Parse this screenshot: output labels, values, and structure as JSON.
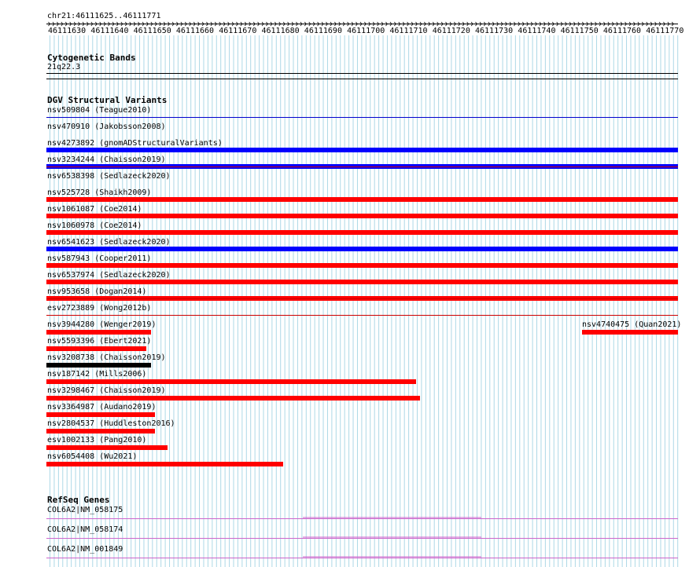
{
  "location": "chr21:46111625..46111771",
  "colors": {
    "grid": "#add8e6",
    "gain": "#0000ff",
    "loss": "#ff0000",
    "complex": "#000000",
    "gene": "#cc66cc",
    "separator_red": "#cc0000",
    "separator_blue": "#0000cc"
  },
  "ruler": {
    "ticks": [
      "46111630",
      "46111640",
      "46111650",
      "46111660",
      "46111670",
      "46111680",
      "46111690",
      "46111700",
      "46111710",
      "46111720",
      "46111730",
      "46111740",
      "46111750",
      "46111760",
      "46111770"
    ]
  },
  "tracks": {
    "cytoband": {
      "title": "Cytogenetic Bands",
      "band": "21q22.3"
    },
    "dgv": {
      "title": "DGV Structural Variants",
      "variants": [
        {
          "label": "nsv509804 (Teague2010)",
          "type": "none",
          "sep": "blue"
        },
        {
          "label": "nsv470910 (Jakobsson2008)",
          "type": "gain",
          "sep": "blue"
        },
        {
          "label": "nsv4273892 (gnomADStructuralVariants)",
          "type": "gain",
          "sep": "blue"
        },
        {
          "label": "nsv3234244 (Chaisson2019)",
          "type": "none",
          "sep": "red"
        },
        {
          "label": "nsv6538398 (Sedlazeck2020)",
          "type": "loss",
          "sep": "red"
        },
        {
          "label": "nsv525728 (Shaikh2009)",
          "type": "loss",
          "sep": "red"
        },
        {
          "label": "nsv1061087 (Coe2014)",
          "type": "loss",
          "sep": "red"
        },
        {
          "label": "nsv1060978 (Coe2014)",
          "type": "gain",
          "sep": "red"
        },
        {
          "label": "nsv6541623 (Sedlazeck2020)",
          "type": "loss",
          "sep": "red"
        },
        {
          "label": "nsv587943 (Cooper2011)",
          "type": "loss",
          "sep": "red"
        },
        {
          "label": "nsv6537974 (Sedlazeck2020)",
          "type": "loss",
          "sep": "red"
        },
        {
          "label": "nsv953658 (Dogan2014)",
          "type": "none",
          "sep": "red"
        },
        {
          "label": "esv2723889 (Wong2012b)",
          "type": "none",
          "sep": "red"
        }
      ],
      "partial": [
        {
          "label": "nsv3944280 (Wenger2019)",
          "type": "loss"
        },
        {
          "label": "nsv5593396 (Ebert2021)",
          "type": "loss"
        },
        {
          "label": "nsv3208738 (Chaisson2019)",
          "type": "complex"
        },
        {
          "label": "nsv187142 (Mills2006)",
          "type": "loss"
        },
        {
          "label": "nsv3298467 (Chaisson2019)",
          "type": "loss"
        },
        {
          "label": "nsv3364987 (Audano2019)",
          "type": "loss"
        },
        {
          "label": "nsv2804537 (Huddleston2016)",
          "type": "loss"
        },
        {
          "label": "esv1002133 (Pang2010)",
          "type": "loss"
        },
        {
          "label": "nsv6054408 (Wu2021)",
          "type": "loss"
        }
      ],
      "right_variant": {
        "label": "nsv4740475 (Quan2021)",
        "type": "loss"
      }
    },
    "refseq": {
      "title": "RefSeq Genes",
      "genes": [
        {
          "label": "COL6A2|NM_058175"
        },
        {
          "label": "COL6A2|NM_058174"
        },
        {
          "label": "COL6A2|NM_001849"
        }
      ]
    }
  }
}
